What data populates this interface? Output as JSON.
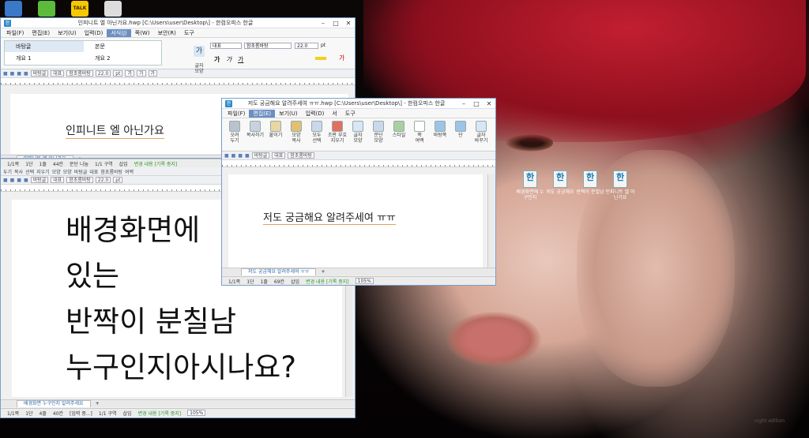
{
  "taskbar_icons": [
    {
      "name": "computer-icon",
      "color": "#3a78c8"
    },
    {
      "name": "frog-icon",
      "color": "#5cbb3a"
    },
    {
      "name": "talk-icon",
      "label": "TALK",
      "color": "#f7c800"
    },
    {
      "name": "calendar-icon",
      "color": "#ddd"
    }
  ],
  "desktop_icons": [
    {
      "label": "배경화면에 누구인지",
      "glyph": "한"
    },
    {
      "label": "저도 궁금해요",
      "glyph": "한"
    },
    {
      "label": "반짝이 분칠남",
      "glyph": "한"
    },
    {
      "label": "인피니트 엘 아닌가요",
      "glyph": "한"
    }
  ],
  "corner_text": "night edition",
  "win1": {
    "title": "인피니트 엘 아닌가요.hwp [C:\\Users\\user\\Desktop\\] - 한컴오피스 한글",
    "menu": [
      "파일(F)",
      "편집(E)",
      "보기(U)",
      "입력(D)",
      "서식(J)",
      "쪽(W)",
      "보안(R)",
      "도구"
    ],
    "active_menu": "서식(J)",
    "styles": [
      "바탕글",
      "본문",
      "개요 1",
      "개요 2"
    ],
    "font1": "대표",
    "font2": "함초롬바탕",
    "size": "22.0",
    "unit": "pt",
    "big_label": "글자\n모양",
    "toolrow": [
      "바탕글",
      "대표",
      "함초롬바탕",
      "22.0",
      "pt",
      "가",
      "가",
      "가"
    ],
    "doc_text": "인피니트 엘 아닌가요",
    "tab": "인피니트 엘 아닌가요",
    "status": [
      "1/1쪽",
      "1단",
      "1줄",
      "44칸",
      "문단 나눔",
      "1/1 구역",
      "삽입",
      "변경 내용 [기록 중지]"
    ]
  },
  "win2": {
    "toolrow1": [
      "두기",
      "복사",
      "선택",
      "지우기",
      "모양",
      "모양",
      "바탕글",
      "대표",
      "함초롬바탕",
      "여백"
    ],
    "lines": [
      "배경화면에",
      "있는",
      "반짝이 분칠남",
      "누구인지아시나요?"
    ],
    "tab": "배경화면 누구인지 알려주세요",
    "status": [
      "1/1쪽",
      "1단",
      "4줄",
      "40칸",
      "[입력 중...]",
      "1/1 구역",
      "삽입",
      "변경 내용 [기록 중지]"
    ],
    "zoom": "105%"
  },
  "win3": {
    "title": "저도 궁금해요 알려주세여 ㅠㅠ.hwp [C:\\Users\\user\\Desktop\\] - 한컴오피스 한글",
    "menu": [
      "파일(F)",
      "편집(E)",
      "보기(U)",
      "입력(D)",
      "서",
      "도구"
    ],
    "active_menu": "편집(E)",
    "ribbon": [
      "오려\n두기",
      "복사하기",
      "붙이기",
      "모양\n복사",
      "모두\n선택",
      "조판 부호\n지우기",
      "글자\n모양",
      "문단\n모양",
      "스타일",
      "쪽\n여백",
      "바탕쪽",
      "단",
      "글자\n바꾸기"
    ],
    "toolrow": [
      "바탕글",
      "대표",
      "함초롬바탕"
    ],
    "doc_text": "저도 궁금해요 알려주세여 ㅠㅠ",
    "tab": "저도 궁금해요 알려주세여 ㅠㅠ",
    "status": [
      "1/1쪽",
      "1단",
      "1줄",
      "69칸",
      "삽입",
      "변경 내용 [기록 중지]"
    ],
    "zoom": "105%"
  }
}
